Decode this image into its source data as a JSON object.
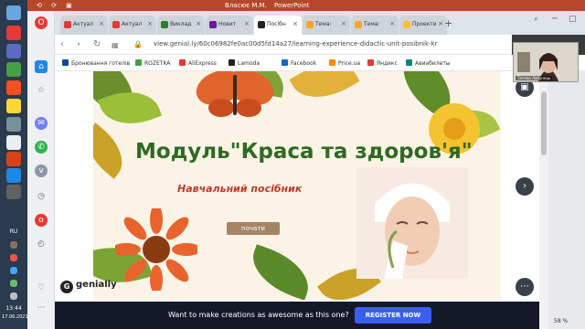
{
  "powerpoint": {
    "quick_access": "⟲ ⟳ ▣",
    "user": "Власює М.М.",
    "title": "PowerPoint"
  },
  "taskbar": {
    "language": "RU",
    "time": "13:44",
    "date": "17.06.2021"
  },
  "tabs": [
    {
      "label": "Актуал",
      "favicon_color": "#e53935"
    },
    {
      "label": "Актуал",
      "favicon_color": "#e53935"
    },
    {
      "label": "Виклад",
      "favicon_color": "#2e7d32"
    },
    {
      "label": "Новит",
      "favicon_color": "#6a1b9a"
    },
    {
      "label": "Посібн",
      "favicon_color": "#222222",
      "active": true
    },
    {
      "label": "Тема:",
      "favicon_color": "#f9a825"
    },
    {
      "label": "Тема:",
      "favicon_color": "#f9a825"
    },
    {
      "label": "Проекти",
      "favicon_color": "#fbc02d"
    }
  ],
  "address_bar": {
    "url": "view.genial.ly/60c06982fe0ac00d5fd14a27/learning-experience-didactic-unit-posibnik-kr"
  },
  "bookmarks": [
    {
      "label": "Бронювання готелів",
      "color": "#0d47a1"
    },
    {
      "label": "ROZETKA",
      "color": "#43a047"
    },
    {
      "label": "AliExpress",
      "color": "#e53935"
    },
    {
      "label": "Lamoda",
      "color": "#222222"
    },
    {
      "label": "Facebook",
      "color": "#1565c0"
    },
    {
      "label": "Price.ua",
      "color": "#fb8c00"
    },
    {
      "label": "Яндекс",
      "color": "#e53935"
    },
    {
      "label": "Авиабилеты",
      "color": "#00897b"
    }
  ],
  "slide": {
    "title": "Модуль\"Краса та здоров'я\"",
    "subtitle": "Навчальний посібник",
    "start_button": "почати"
  },
  "genially": {
    "logo_glyph": "G",
    "logo_text": "genially"
  },
  "banner": {
    "text": "Want to make creations as awesome as this one?",
    "register_label": "REGISTER NOW"
  },
  "webcam_name": "Тетяна Лабунець",
  "zoom": "58 %",
  "colors": {
    "powerpoint": "#b7472a",
    "slide_title": "#2f6a21",
    "subtitle": "#c0392b",
    "register_button": "#3a5ff0",
    "banner": "#15182b"
  }
}
